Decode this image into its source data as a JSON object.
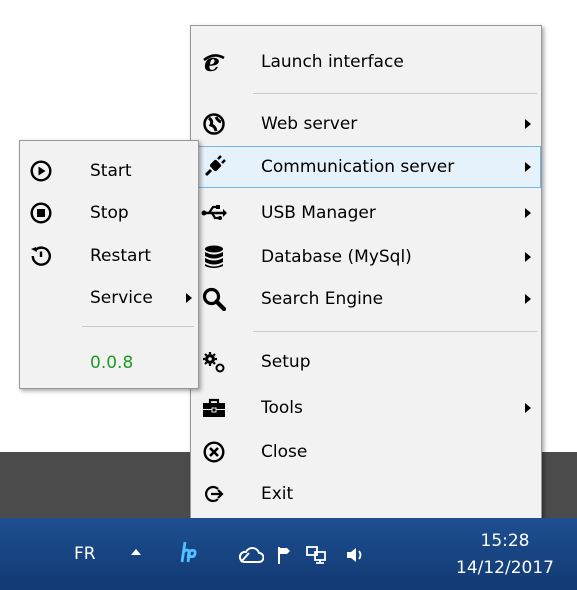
{
  "main_menu": {
    "items": [
      {
        "label": "Launch interface",
        "icon": "ie-icon",
        "submenu": false
      },
      {
        "label": "Web server",
        "icon": "globe-icon",
        "submenu": true
      },
      {
        "label": "Communication server",
        "icon": "plug-icon",
        "submenu": true,
        "highlighted": true
      },
      {
        "label": "USB Manager",
        "icon": "usb-icon",
        "submenu": true
      },
      {
        "label": "Database (MySql)",
        "icon": "database-icon",
        "submenu": true
      },
      {
        "label": "Search Engine",
        "icon": "search-icon",
        "submenu": true
      },
      {
        "label": "Setup",
        "icon": "gears-icon",
        "submenu": false
      },
      {
        "label": "Tools",
        "icon": "toolbox-icon",
        "submenu": true
      },
      {
        "label": "Close",
        "icon": "close-circle-icon",
        "submenu": false
      },
      {
        "label": "Exit",
        "icon": "exit-icon",
        "submenu": false
      }
    ]
  },
  "sub_menu": {
    "items": [
      {
        "label": "Start",
        "icon": "play-circle-icon"
      },
      {
        "label": "Stop",
        "icon": "stop-circle-icon"
      },
      {
        "label": "Restart",
        "icon": "restart-icon"
      },
      {
        "label": "Service",
        "icon": "",
        "submenu": true
      }
    ],
    "version": "0.0.8",
    "version_color": "#1f9c25"
  },
  "taskbar": {
    "language": "FR",
    "time": "15:28",
    "date": "14/12/2017",
    "tray_icons": [
      "show-hidden-icons-chevron",
      "hp-icon",
      "cloud-icon",
      "action-center-flag-icon",
      "network-icon",
      "volume-icon"
    ]
  },
  "colors": {
    "menu_bg": "#f2f2f2",
    "highlight_bg": "#e5f1fb",
    "highlight_border": "#7ab4e6",
    "taskbar": "#1d4f91"
  }
}
